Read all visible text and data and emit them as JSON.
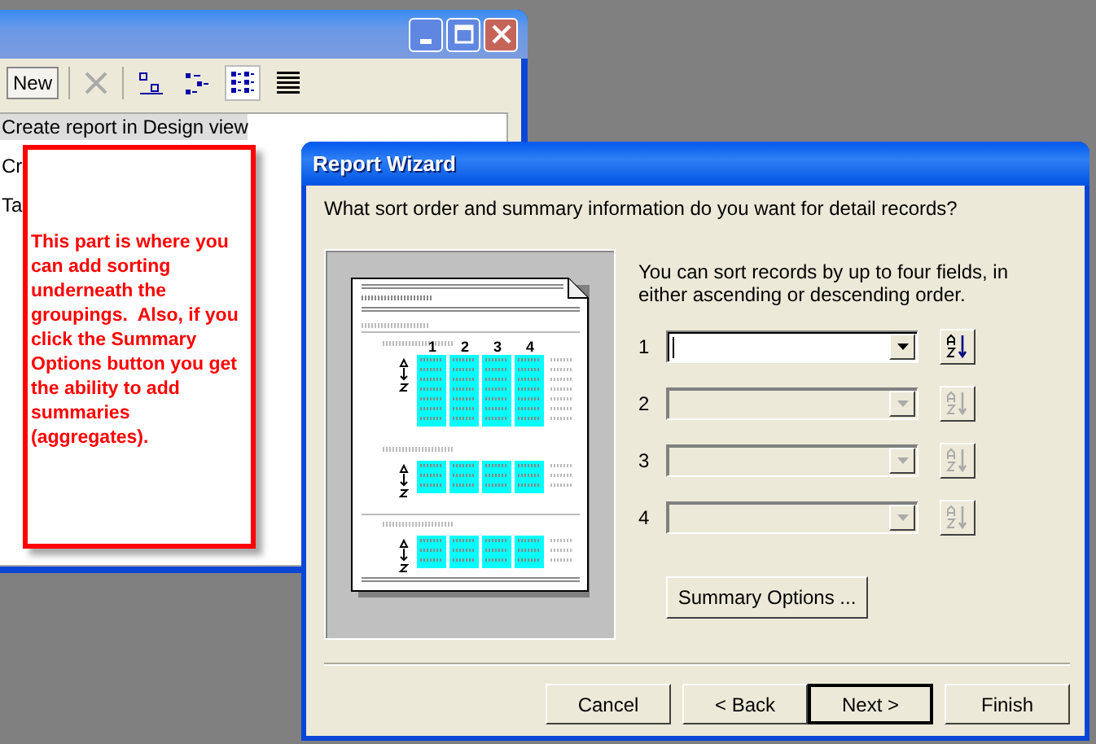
{
  "background_window": {
    "toolbar": [
      {
        "kind": "button",
        "label": "New"
      },
      {
        "kind": "delete",
        "disabled": true
      },
      {
        "kind": "large-icons",
        "selected": false
      },
      {
        "kind": "small-icons",
        "selected": false
      },
      {
        "kind": "list",
        "selected": true
      },
      {
        "kind": "details",
        "selected": false
      }
    ],
    "items": [
      {
        "label": "Create report in Design view",
        "selected": true
      },
      {
        "label": "Cr",
        "selected": false
      },
      {
        "label": "Ta",
        "selected": false
      }
    ]
  },
  "callout": {
    "text": "This part is where you can add sorting underneath the groupings.  Also, if you click the Summary Options button you get the ability to add summaries (aggregates)."
  },
  "wizard": {
    "title": "Report Wizard",
    "question": "What sort order and summary information do you want for detail records?",
    "preview": {
      "column_labels": [
        "1",
        "2",
        "3",
        "4"
      ]
    },
    "hint": "You can sort records by up to four fields, in either ascending or descending order.",
    "sort_fields": [
      {
        "number": "1",
        "enabled": true
      },
      {
        "number": "2",
        "enabled": false
      },
      {
        "number": "3",
        "enabled": false
      },
      {
        "number": "4",
        "enabled": false
      }
    ],
    "summary_button": "Summary Options ...",
    "buttons": [
      {
        "label": "Cancel",
        "default": false
      },
      {
        "label": "< Back",
        "default": false
      },
      {
        "label": "Next >",
        "default": true
      },
      {
        "label": "Finish",
        "default": false
      }
    ]
  }
}
